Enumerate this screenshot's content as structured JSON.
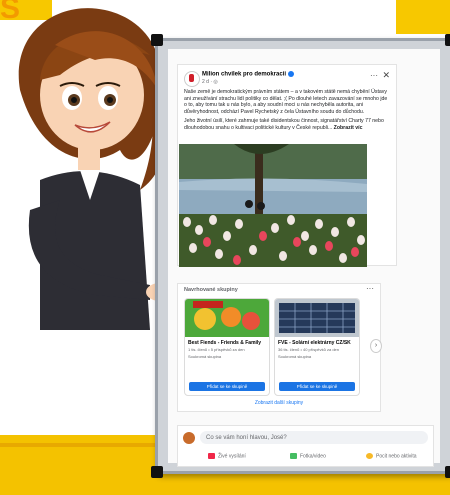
{
  "post": {
    "page_name": "Milion chvilek pro demokracii",
    "meta": "2 d · ",
    "paragraph1": "Naše země je demokratickým právním státem – a v takovém státě nemá chybění Ústavy ani zneužívání strachu lidí politiky co dělat. ;( Po dlouhé letech zavazování se mnoho jde o to, aby tomu tak u nás bylo, a aby soudní moci u nás nechyběla autorita, ani důvěryhodnost, odchází Pavel Rychetský z čela Ústavního soudu do důchodu.",
    "paragraph2": "Jeho životní úsilí, které zahrnuje také disidentskou činnost, signatářství Charty 77 nebo dlouhodobou snahu o kultivaci politické kultury v České republi...",
    "see_more": "Zobrazit víc"
  },
  "groups": {
    "title": "Navrhované skupiny",
    "items": [
      {
        "name": "Best Fiends - Friends & Family",
        "stats": "1 tis. členů • 5 příspěvků za den",
        "type": "Soukromá skupina",
        "join": "Přidat se ke skupině"
      },
      {
        "name": "FVE - Solární elektrárny CZ/SK",
        "stats": "36 tis. členů • 40 příspěvků za den",
        "type": "Soukromá skupina",
        "join": "Přidat se ke skupině"
      }
    ],
    "show_more": "Zobrazit další skupiny"
  },
  "composer": {
    "placeholder": "Co se vám honí hlavou, José?",
    "actions": [
      "Živé vysílání",
      "Fotka/video",
      "Pocit nebo aktivita"
    ]
  },
  "colors": {
    "facebook_blue": "#1877f2",
    "join_button": "#1b74e4",
    "background_yellow": "#f4c200"
  }
}
